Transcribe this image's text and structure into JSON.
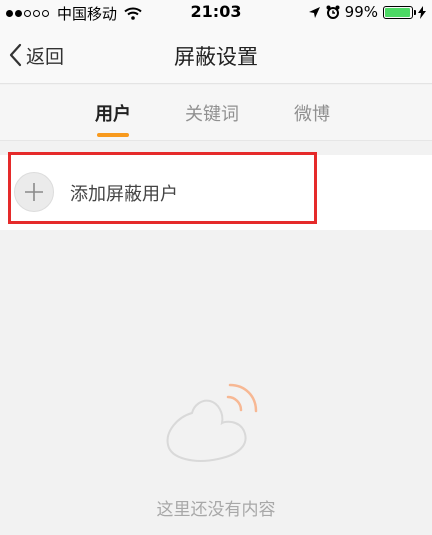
{
  "status_bar": {
    "carrier": "中国移动",
    "time": "21:03",
    "battery": "99%"
  },
  "nav": {
    "back_label": "返回",
    "title": "屏蔽设置"
  },
  "tabs": [
    {
      "label": "用户",
      "active": true
    },
    {
      "label": "关键词",
      "active": false
    },
    {
      "label": "微博",
      "active": false
    }
  ],
  "add_row": {
    "label": "添加屏蔽用户"
  },
  "empty_state": {
    "text": "这里还没有内容"
  },
  "colors": {
    "accent": "#f89a1e",
    "highlight": "#e52a2a",
    "battery": "#4cd964"
  }
}
